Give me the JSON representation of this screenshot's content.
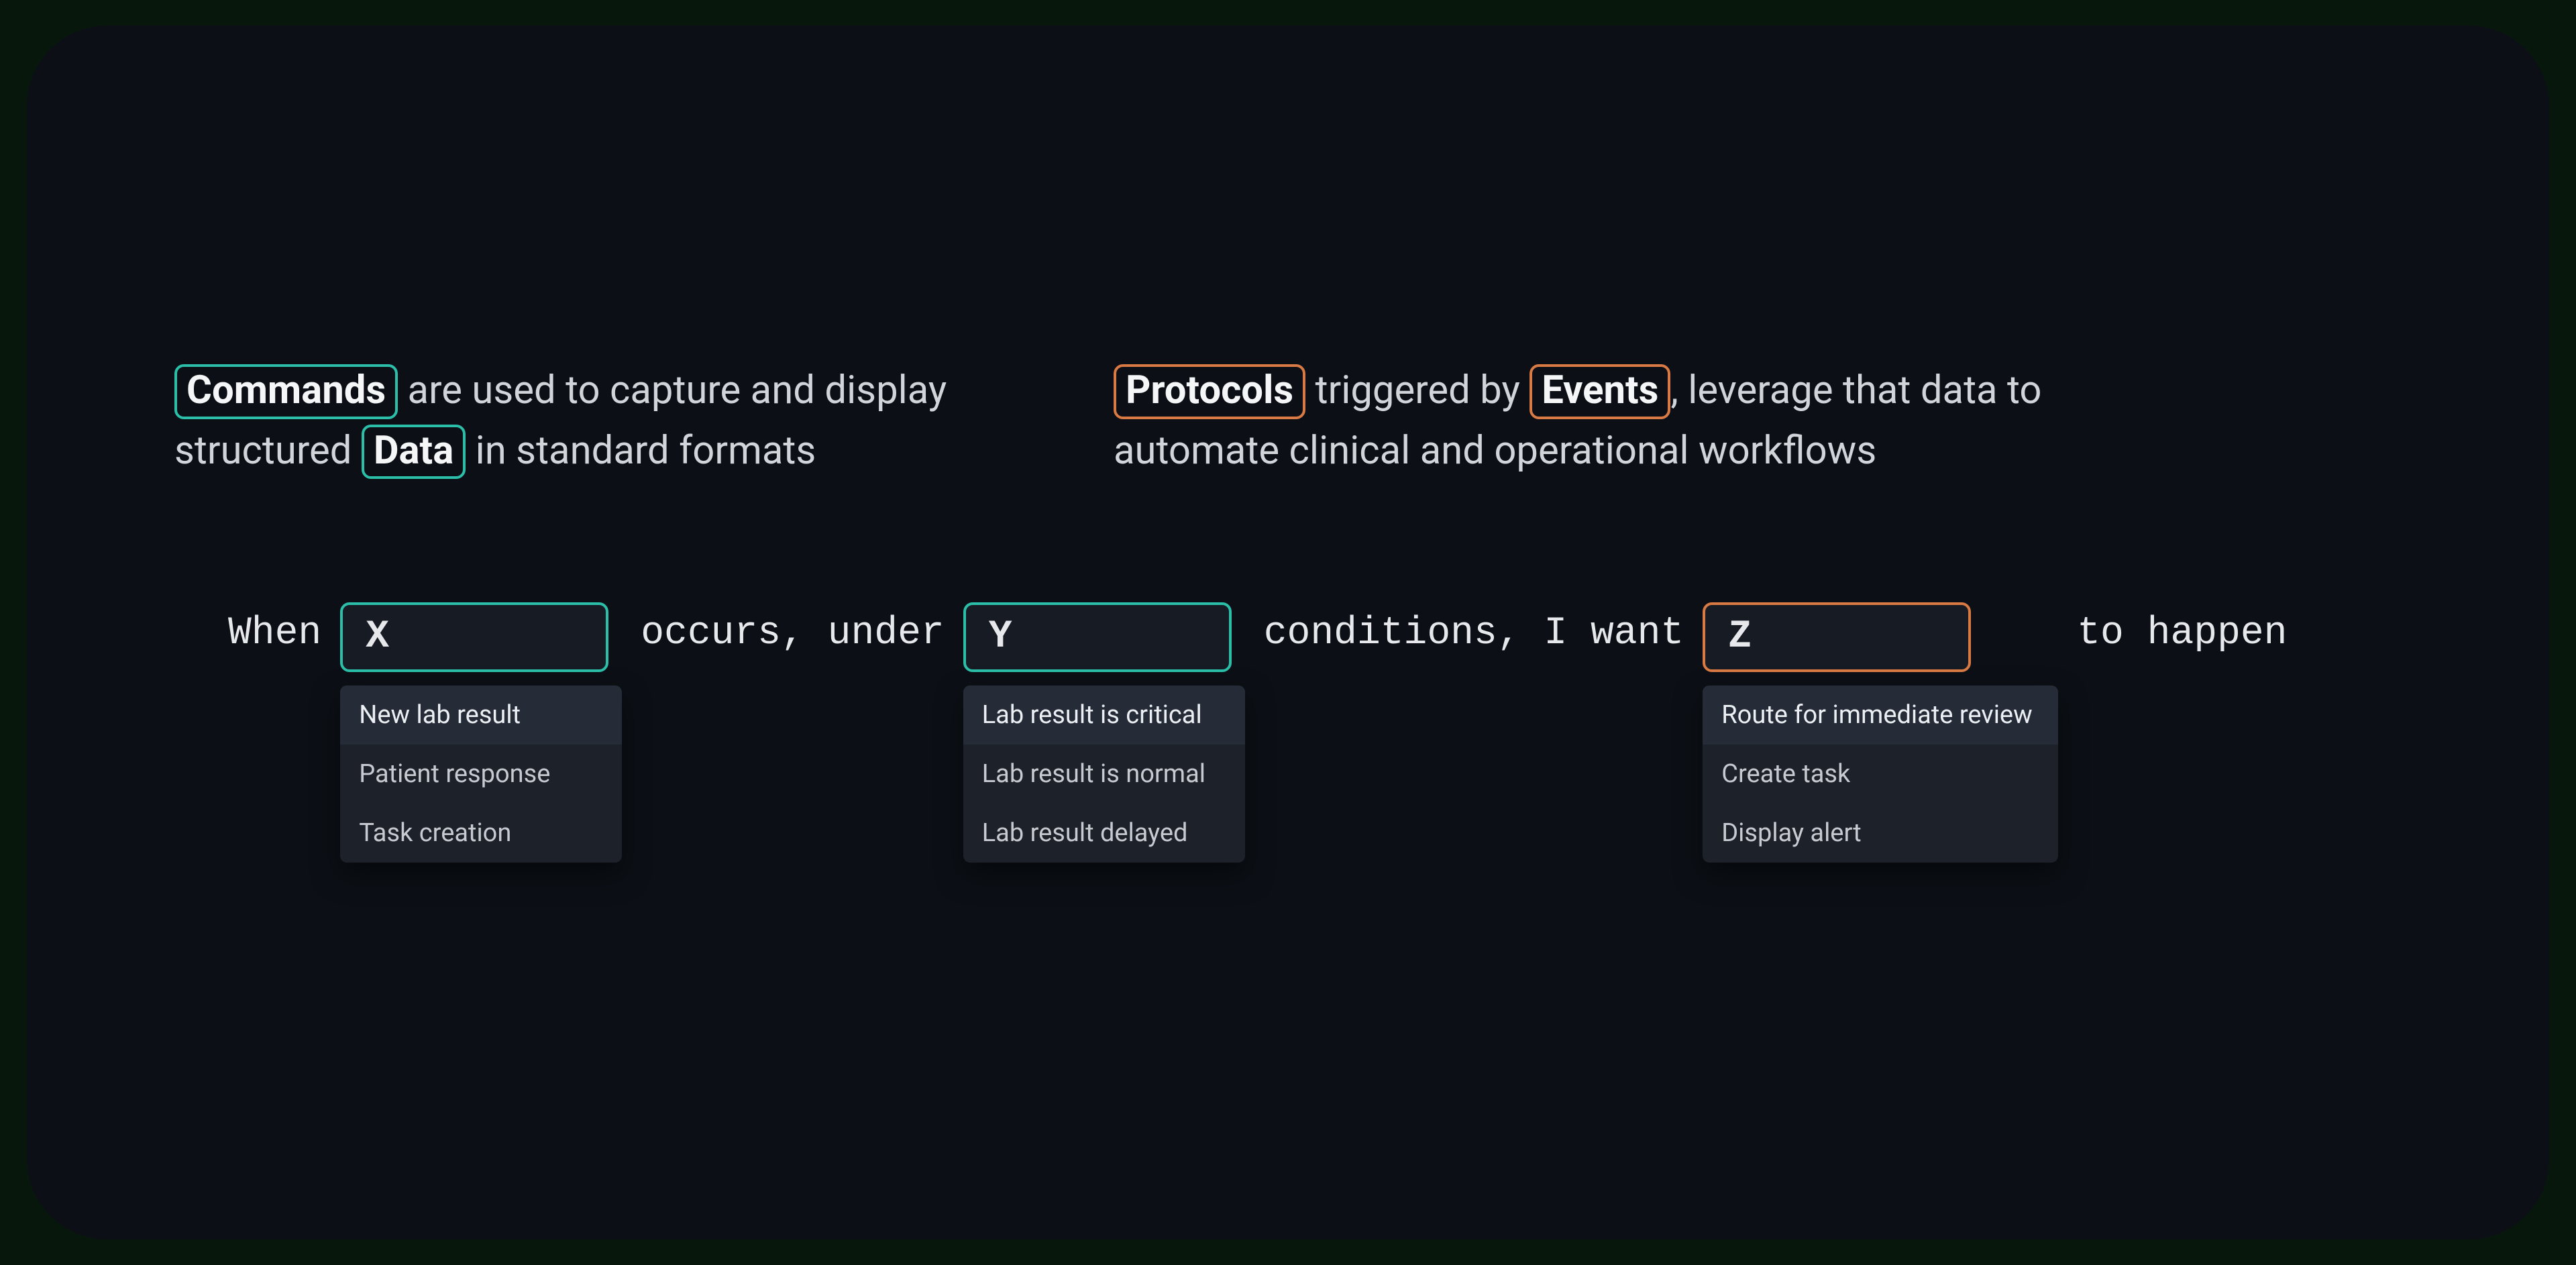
{
  "descriptions": {
    "left": {
      "chip_commands": "Commands",
      "seg1": " are used to capture and display structured ",
      "chip_data": "Data",
      "seg2": " in standard formats"
    },
    "right": {
      "chip_protocols": "Protocols",
      "seg1": " triggered by ",
      "chip_events": "Events",
      "seg2": ", leverage that data to automate clinical and operational workflows"
    }
  },
  "formula": {
    "w_when": "When",
    "w_occurs_under": "occurs, under",
    "w_conditions_want": "conditions, I want",
    "w_to_happen": "to happen",
    "x": {
      "value": "X",
      "options": [
        "New lab result",
        "Patient response",
        "Task creation"
      ],
      "selected_index": 0
    },
    "y": {
      "value": "Y",
      "options": [
        "Lab result is critical",
        "Lab result is normal",
        "Lab result delayed"
      ],
      "selected_index": 0
    },
    "z": {
      "value": "Z",
      "options": [
        "Route for immediate review",
        "Create task",
        "Display alert"
      ],
      "selected_index": 0
    }
  },
  "colors": {
    "teal": "#2dd4bf",
    "orange": "#e88c55"
  }
}
